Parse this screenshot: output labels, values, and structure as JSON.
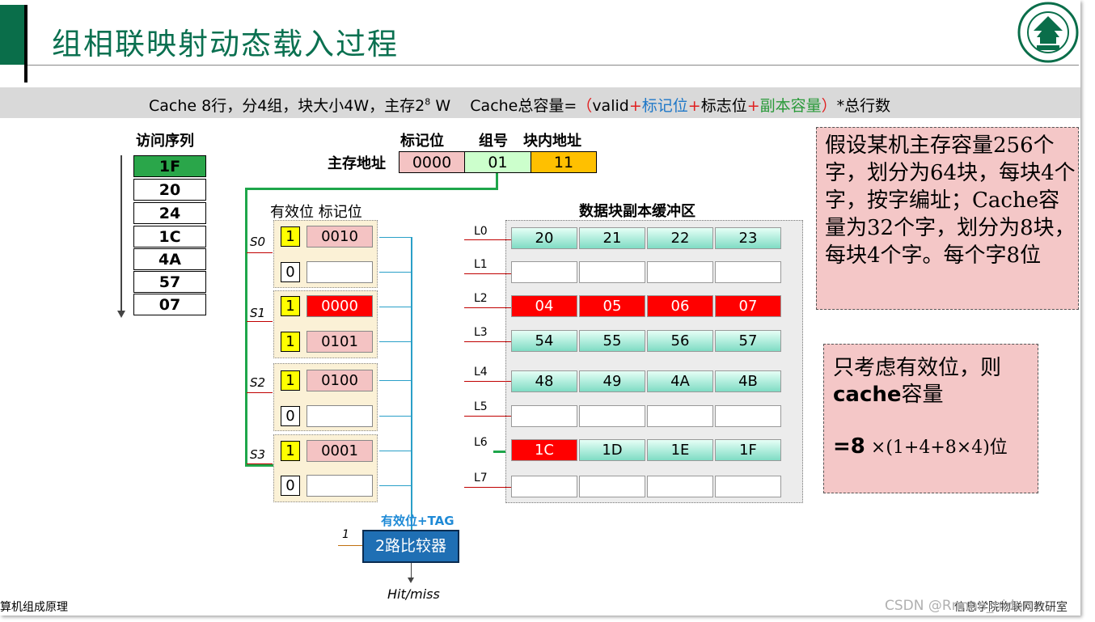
{
  "title": "组相联映射动态载入过程",
  "info": {
    "left": "Cache 8行，分4组，块大小4W，主存2",
    "sup": "8",
    "w": " W",
    "formula_prefix": "Cache总容量=",
    "p_open": "（",
    "valid": "valid",
    "plus": "+",
    "tag": "标记位",
    "flag": "标志位",
    "copy": "副本容量",
    "p_close": "）",
    "suffix": "*总行数"
  },
  "sequence": {
    "header": "访问序列",
    "items": [
      "1F",
      "20",
      "24",
      "1C",
      "4A",
      "57",
      "07"
    ]
  },
  "address": {
    "label": "主存地址",
    "h_tag": "标记位",
    "h_group": "组号",
    "h_offset": "块内地址",
    "tag": "0000",
    "group": "01",
    "offset": "11"
  },
  "sets": {
    "header": "有效位 标记位",
    "labels": [
      "S0",
      "S1",
      "S2",
      "S3"
    ],
    "rows": [
      {
        "v": "1",
        "tag": "0010"
      },
      {
        "v": "0",
        "tag": ""
      },
      {
        "v": "1",
        "tag": "0000"
      },
      {
        "v": "1",
        "tag": "0101"
      },
      {
        "v": "1",
        "tag": "0100"
      },
      {
        "v": "0",
        "tag": ""
      },
      {
        "v": "1",
        "tag": "0001"
      },
      {
        "v": "0",
        "tag": ""
      }
    ]
  },
  "buffer": {
    "title": "数据块副本缓冲区",
    "lines": [
      "L0",
      "L1",
      "L2",
      "L3",
      "L4",
      "L5",
      "L6",
      "L7"
    ],
    "rows": [
      [
        "20",
        "21",
        "22",
        "23"
      ],
      [
        "",
        "",
        "",
        ""
      ],
      [
        "04",
        "05",
        "06",
        "07"
      ],
      [
        "54",
        "55",
        "56",
        "57"
      ],
      [
        "48",
        "49",
        "4A",
        "4B"
      ],
      [
        "",
        "",
        "",
        ""
      ],
      [
        "1C",
        "1D",
        "1E",
        "1F"
      ],
      [
        "",
        "",
        "",
        ""
      ]
    ]
  },
  "note1": "假设某机主存容量256个字，划分为64块，每块4个字，按字编址；Cache容量为32个字，划分为8块，每块4个字。每个字8位",
  "note2": {
    "line1": "只考虑有效位，则",
    "line2_bold": "cache",
    "line2_rest": "容量",
    "line3_bold": "=8",
    "line3_rest": " ×(1+4+8×4)位"
  },
  "comparator": {
    "label": "有效位+TAG",
    "name": "2路比较器",
    "input": "1",
    "output": "Hit/miss"
  },
  "footer": {
    "left": "算机组成原理",
    "right": "信息学院物联网教研室",
    "watermark": "CSDN @Rnnnn_niden"
  },
  "colors": {
    "title_green": "#0a7050",
    "highlight_red": "#ff0000",
    "bus_green": "#1ea64a",
    "valid_yellow": "#ffff00",
    "note_pink": "#f4c7c7"
  }
}
